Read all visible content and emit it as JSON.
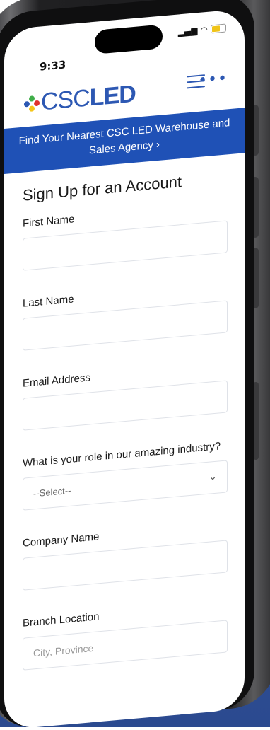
{
  "status_bar": {
    "time": "9:33",
    "signal_icon": "signal-icon",
    "wifi_icon": "wifi-icon",
    "battery_icon": "battery-icon"
  },
  "header": {
    "logo_prefix": "CSC",
    "logo_suffix": "LED",
    "menu_icon": "hamburger-menu-icon",
    "more_icon": "more-dots-icon"
  },
  "banner": {
    "text": "Find Your Nearest CSC LED Warehouse and Sales Agency ›"
  },
  "form": {
    "title": "Sign Up for an Account",
    "fields": [
      {
        "label": "First Name",
        "value": "",
        "placeholder": ""
      },
      {
        "label": "Last Name",
        "value": "",
        "placeholder": ""
      },
      {
        "label": "Email Address",
        "value": "",
        "placeholder": ""
      },
      {
        "label": "What is your role in our amazing industry?",
        "selected": "--Select--"
      },
      {
        "label": "Company Name",
        "value": "",
        "placeholder": ""
      },
      {
        "label": "Branch Location",
        "value": "",
        "placeholder": "City, Province"
      }
    ]
  },
  "colors": {
    "brand_blue": "#2d58b3",
    "banner_blue": "#1f51b6",
    "logo_dot_green": "#3fae49",
    "logo_dot_red": "#e0312b",
    "logo_dot_yellow": "#f5c518",
    "logo_dot_blue": "#2d58b3",
    "background_blue": "#2f4f97"
  }
}
